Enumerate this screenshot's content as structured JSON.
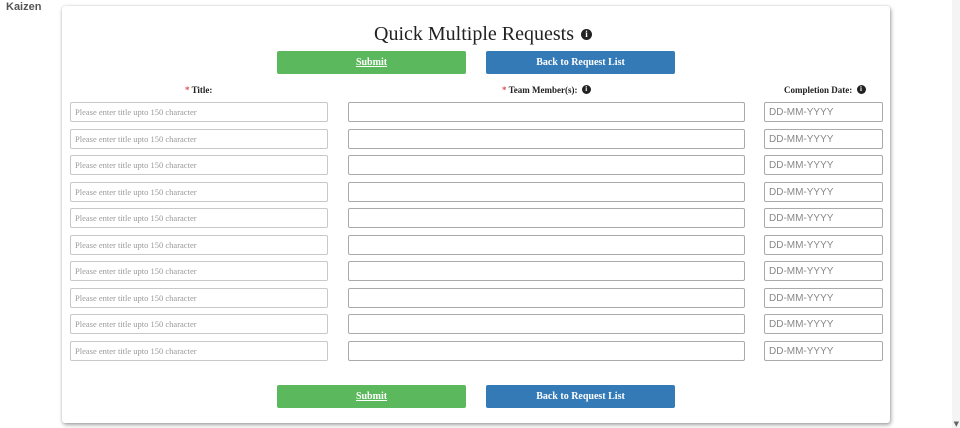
{
  "app": {
    "name": "Kaizen"
  },
  "page": {
    "title": "Quick Multiple Requests",
    "title_info_icon": "info-circle-icon"
  },
  "buttons": {
    "submit_label": "Submit",
    "back_label": "Back to Request List",
    "submit_color": "#5cb85c",
    "back_color": "#337ab7"
  },
  "columns": {
    "required_mark": "*",
    "title": "Title:",
    "team_members": "Team Member(s):",
    "completion_date": "Completion Date:"
  },
  "rows": [
    {
      "title": "",
      "team_members": "",
      "completion_date": ""
    },
    {
      "title": "",
      "team_members": "",
      "completion_date": ""
    },
    {
      "title": "",
      "team_members": "",
      "completion_date": ""
    },
    {
      "title": "",
      "team_members": "",
      "completion_date": ""
    },
    {
      "title": "",
      "team_members": "",
      "completion_date": ""
    },
    {
      "title": "",
      "team_members": "",
      "completion_date": ""
    },
    {
      "title": "",
      "team_members": "",
      "completion_date": ""
    },
    {
      "title": "",
      "team_members": "",
      "completion_date": ""
    },
    {
      "title": "",
      "team_members": "",
      "completion_date": ""
    },
    {
      "title": "",
      "team_members": "",
      "completion_date": ""
    }
  ],
  "placeholders": {
    "title": "Please enter title upto 150 character",
    "completion_date": "DD-MM-YYYY"
  },
  "colors": {
    "required": "#d9534f"
  }
}
